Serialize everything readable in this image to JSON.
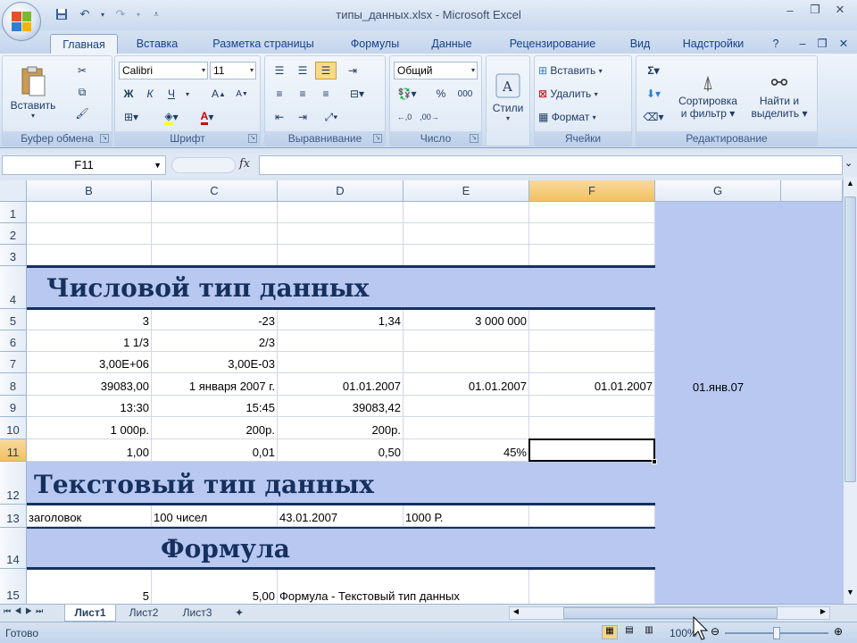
{
  "window": {
    "title": "типы_данных.xlsx - Microsoft Excel"
  },
  "tabs": [
    {
      "label": "Главная",
      "active": true
    },
    {
      "label": "Вставка"
    },
    {
      "label": "Разметка страницы"
    },
    {
      "label": "Формулы"
    },
    {
      "label": "Данные"
    },
    {
      "label": "Рецензирование"
    },
    {
      "label": "Вид"
    },
    {
      "label": "Надстройки"
    }
  ],
  "ribbon": {
    "clipboard": {
      "label": "Буфер обмена",
      "paste": "Вставить"
    },
    "font": {
      "label": "Шрифт",
      "name": "Calibri",
      "size": "11",
      "bold": "Ж",
      "italic": "К",
      "underline": "Ч"
    },
    "alignment": {
      "label": "Выравнивание"
    },
    "number": {
      "label": "Число",
      "format": "Общий"
    },
    "styles": {
      "label": "Стили"
    },
    "cells": {
      "label": "Ячейки",
      "insert": "Вставить",
      "delete": "Удалить",
      "format": "Формат"
    },
    "editing": {
      "label": "Редактирование",
      "sort_line1": "Сортировка",
      "sort_line2": "и фильтр",
      "find_line1": "Найти и",
      "find_line2": "выделить"
    }
  },
  "formula_bar": {
    "name_box": "F11",
    "fx": "fx",
    "content": ""
  },
  "columns": [
    "B",
    "C",
    "D",
    "E",
    "F",
    "G"
  ],
  "rows": [
    "1",
    "2",
    "3",
    "4",
    "5",
    "6",
    "7",
    "8",
    "9",
    "10",
    "11",
    "12",
    "13",
    "14",
    "15"
  ],
  "selected_cell": "F11",
  "headings": {
    "r4": "Числовой тип данных",
    "r12": "Текстовый тип данных",
    "r14": "Формула"
  },
  "cells": {
    "r5": [
      "3",
      "-23",
      "1,34",
      "3 000 000",
      ""
    ],
    "r6": [
      "1 1/3",
      "2/3",
      "",
      "",
      ""
    ],
    "r7": [
      "3,00E+06",
      "3,00E-03",
      "",
      "",
      ""
    ],
    "r8": [
      "39083,00",
      "1 января 2007 г.",
      "01.01.2007",
      "01.01.2007",
      "01.01.2007",
      "01.янв.07"
    ],
    "r9": [
      "13:30",
      "15:45",
      "39083,42",
      "",
      ""
    ],
    "r10": [
      "1 000р.",
      "200р.",
      "200р.",
      "",
      ""
    ],
    "r11": [
      "1,00",
      "0,01",
      "0,50",
      "45%",
      ""
    ],
    "r13": [
      "заголовок",
      "100 чисел",
      "43.01.2007",
      "1000 Р.",
      ""
    ],
    "r15": [
      "5",
      "5,00",
      "Формула - Текстовый тип данных",
      "",
      ""
    ]
  },
  "sheets": [
    {
      "label": "Лист1",
      "active": true
    },
    {
      "label": "Лист2"
    },
    {
      "label": "Лист3"
    }
  ],
  "status": {
    "ready": "Готово",
    "zoom": "100%"
  }
}
